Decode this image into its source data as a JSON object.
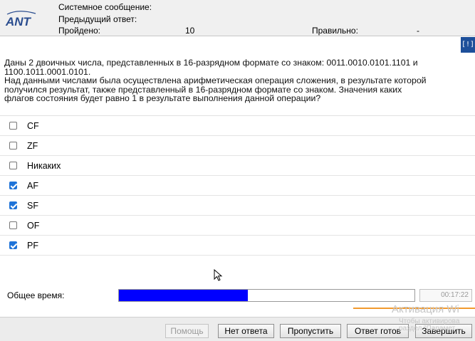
{
  "header": {
    "system_message_label": "Системное сообщение:",
    "previous_answer_label": "Предыдущий ответ:",
    "passed_label": "Пройдено:",
    "passed_value": "10",
    "correct_label": "Правильно:",
    "correct_value": "-",
    "logo_text": "ANT"
  },
  "flag_button": "[!]",
  "question": {
    "line1": "Даны 2 двоичных числа, представленных в 16-разрядном формате со знаком: 0011.0010.0101.1101 и",
    "line2": "1100.1011.0001.0101.",
    "line3": "Над данными числами была осуществлена арифметическая операция сложения, в результате которой",
    "line4": "получился результат, также представленный в 16-разрядном формате со знаком. Значения каких",
    "line5": "флагов состояния будет равно 1 в результате выполнения данной операции?"
  },
  "options": [
    {
      "label": "CF",
      "checked": false
    },
    {
      "label": "ZF",
      "checked": false
    },
    {
      "label": "Никаких",
      "checked": false
    },
    {
      "label": "AF",
      "checked": true
    },
    {
      "label": "SF",
      "checked": true
    },
    {
      "label": "OF",
      "checked": false
    },
    {
      "label": "PF",
      "checked": true
    }
  ],
  "timer": {
    "label": "Общее время:",
    "progress_fraction": 0.435,
    "value": "00:17:22"
  },
  "buttons": {
    "help": "Помощь",
    "no_answer": "Нет ответа",
    "skip": "Пропустить",
    "answer_ready": "Ответ готов",
    "finish": "Завершить"
  },
  "watermark": {
    "title": "Активация Wi",
    "line1": "Чтобы активирова",
    "line2": "раздел \"Парамет"
  },
  "colors": {
    "progress_fill": "#0000ff",
    "checkbox_on": "#1e73d8",
    "flag_bg": "#1d4f9a"
  }
}
